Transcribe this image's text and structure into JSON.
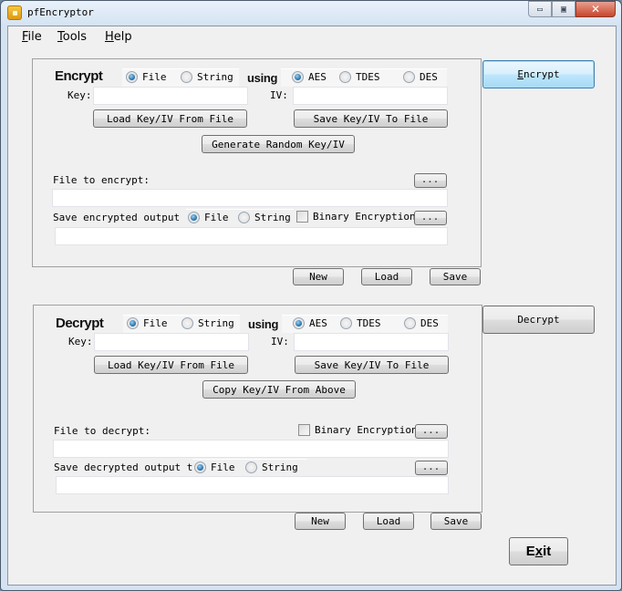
{
  "window": {
    "title": "pfEncryptor",
    "controls": {
      "minimize": "▭",
      "maximize": "▣",
      "close": "✕"
    }
  },
  "menu": [
    {
      "label": "File",
      "mnemonic": "F",
      "rest": "ile"
    },
    {
      "label": "Tools",
      "mnemonic": "T",
      "rest": "ools"
    },
    {
      "label": "Help",
      "mnemonic": "H",
      "rest": "elp"
    }
  ],
  "encrypt": {
    "heading": "Encrypt",
    "source_options": [
      {
        "label": "File",
        "selected": true
      },
      {
        "label": "String",
        "selected": false
      }
    ],
    "using_label": "using",
    "algorithms": [
      {
        "label": "AES",
        "selected": true
      },
      {
        "label": "TDES",
        "selected": false
      },
      {
        "label": "DES",
        "selected": false
      }
    ],
    "key_label": "Key:",
    "key_value": "",
    "iv_label": "IV:",
    "iv_value": "",
    "load_key_button": "Load Key/IV From File",
    "save_key_button": "Save Key/IV To File",
    "generate_button": "Generate Random Key/IV",
    "file_label": "File to encrypt:",
    "file_value": "",
    "browse_label": "...",
    "output_label": "Save encrypted output to",
    "output_options": [
      {
        "label": "File",
        "selected": true
      },
      {
        "label": "String",
        "selected": false
      }
    ],
    "binary_label": "Binary Encryption",
    "binary_checked": false,
    "output_value": "",
    "new_button": "New",
    "load_button": "Load",
    "save_button": "Save",
    "action_button": "Encrypt",
    "action_mnemonic": "E",
    "action_rest": "ncrypt"
  },
  "decrypt": {
    "heading": "Decrypt",
    "source_options": [
      {
        "label": "File",
        "selected": true
      },
      {
        "label": "String",
        "selected": false
      }
    ],
    "using_label": "using",
    "algorithms": [
      {
        "label": "AES",
        "selected": true
      },
      {
        "label": "TDES",
        "selected": false
      },
      {
        "label": "DES",
        "selected": false
      }
    ],
    "key_label": "Key:",
    "key_value": "",
    "iv_label": "IV:",
    "iv_value": "",
    "load_key_button": "Load Key/IV From File",
    "save_key_button": "Save Key/IV To File",
    "copy_button": "Copy Key/IV From Above",
    "file_label": "File to decrypt:",
    "file_value": "",
    "browse_label": "...",
    "binary_label": "Binary Encryption",
    "binary_checked": false,
    "output_label": "Save decrypted output to",
    "output_options": [
      {
        "label": "File",
        "selected": true
      },
      {
        "label": "String",
        "selected": false
      }
    ],
    "output_value": "",
    "new_button": "New",
    "load_button": "Load",
    "save_button": "Save",
    "action_button": "Decrypt"
  },
  "exit_button": {
    "mnemonic_before": "E",
    "mnemonic": "x",
    "rest": "it"
  }
}
